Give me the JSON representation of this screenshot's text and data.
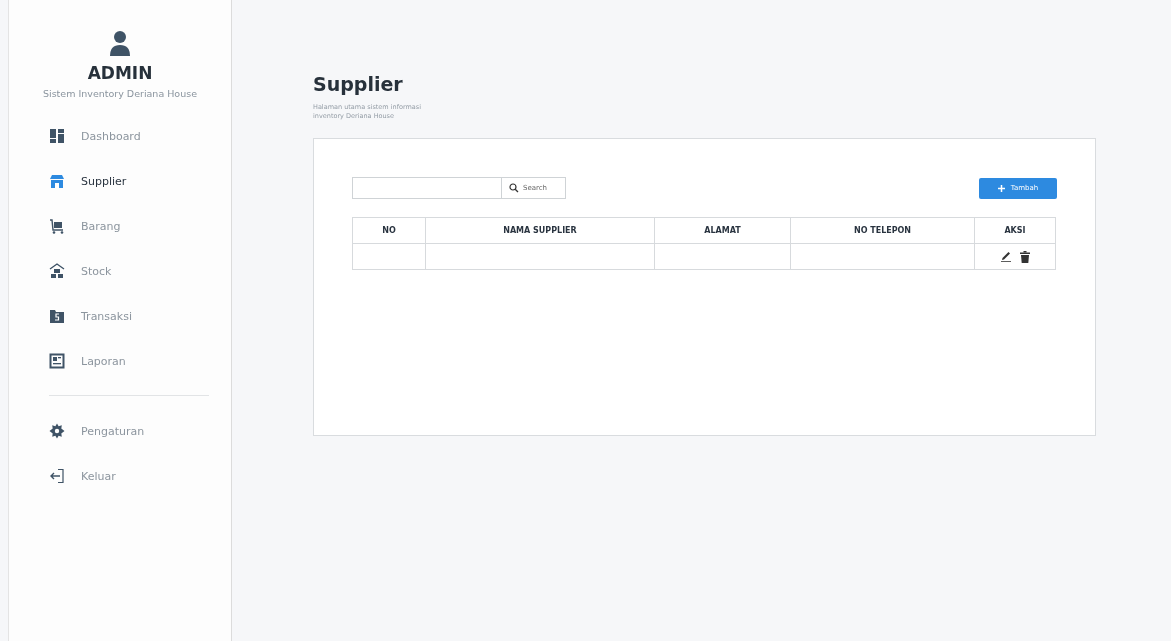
{
  "profile": {
    "name": "ADMIN",
    "subtitle": "Sistem Inventory Deriana House"
  },
  "menu": [
    {
      "label": "Dashboard",
      "selected": false
    },
    {
      "label": "Supplier",
      "selected": true
    },
    {
      "label": "Barang",
      "selected": false
    },
    {
      "label": "Stock",
      "selected": false
    },
    {
      "label": "Transaksi",
      "selected": false
    },
    {
      "label": "Laporan",
      "selected": false
    }
  ],
  "bottom_menu": [
    {
      "label": "Pengaturan",
      "selected": false
    },
    {
      "label": "Keluar",
      "selected": false
    }
  ],
  "page": {
    "title": "Supplier",
    "description": "Halaman utama sistem informasi inventory Deriana House"
  },
  "search": {
    "button": "Search"
  },
  "add_button": "Tambah",
  "table": {
    "columns": [
      "NO",
      "NAMA SUPPLIER",
      "ALAMAT",
      "NO TELEPON",
      "AKSI"
    ],
    "rows": [
      {
        "cells": [
          "",
          "",
          "",
          ""
        ]
      }
    ]
  }
}
